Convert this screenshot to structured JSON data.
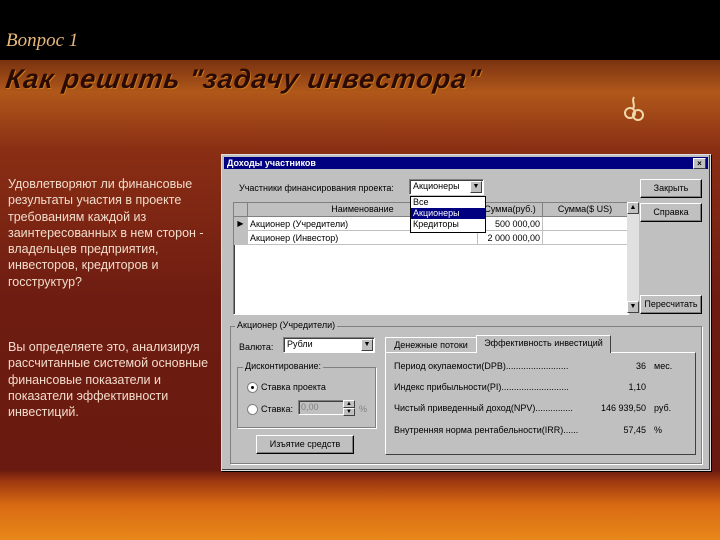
{
  "slide": {
    "question": "Вопрос 1",
    "title": "Как решить \"задачу инвестора\"",
    "paragraph1": "Удовлетворяют ли финансовые результаты участия в проекте требованиям каждой из заинтересованных в нем сторон - владельцев предприятия, инвесторов, кредиторов и госструктур?",
    "paragraph2": "Вы определяете это, анализируя рассчитанные системой основные финансовые показатели и показатели эффективности инвестиций."
  },
  "dialog": {
    "title": "Доходы участников",
    "close_symbol": "×",
    "participants_label": "Участники финансирования проекта:",
    "participants_value": "Акционеры",
    "dropdown_options": [
      "Все",
      "Акционеры",
      "Кредиторы"
    ],
    "dropdown_selected_index": 1,
    "buttons": {
      "close": "Закрыть",
      "help": "Справка",
      "recalc": "Пересчитать",
      "withdraw": "Изъятие средств"
    },
    "table": {
      "columns": [
        "Наименование",
        "Сумма(руб.)",
        "Сумма($ US)"
      ],
      "rows": [
        {
          "marker": "▶",
          "name": "Акционер (Учредители)",
          "rub": "500 000,00",
          "usd": ""
        },
        {
          "marker": "",
          "name": "Акционер (Инвестор)",
          "rub": "2 000 000,00",
          "usd": ""
        }
      ]
    },
    "shareholder_group": "Акционер (Учредители)",
    "currency_label": "Валюта:",
    "currency_value": "Рубли",
    "discount_group": "Дисконтирование:",
    "radio_rate": "Ставка проекта",
    "radio_rate_checked": true,
    "radio_custom": "Ставка:",
    "rate_value": "0,00",
    "rate_unit": "%",
    "tabs": [
      "Денежные потоки",
      "Эффективность инвестиций"
    ],
    "active_tab": 1,
    "metrics": [
      {
        "label": "Период окупаемости(DPB).........................",
        "value": "36",
        "unit": "мес."
      },
      {
        "label": "Индекс прибыльности(PI)...........................",
        "value": "1,10",
        "unit": ""
      },
      {
        "label": "Чистый приведенный доход(NPV)...............",
        "value": "146 939,50",
        "unit": "руб."
      },
      {
        "label": "Внутренняя норма рентабельности(IRR)......",
        "value": "57,45",
        "unit": "%"
      }
    ]
  },
  "colors": {
    "title_bar": "#000080",
    "dialog_face": "#c0c0c0",
    "slide_text": "#f2dccb"
  }
}
